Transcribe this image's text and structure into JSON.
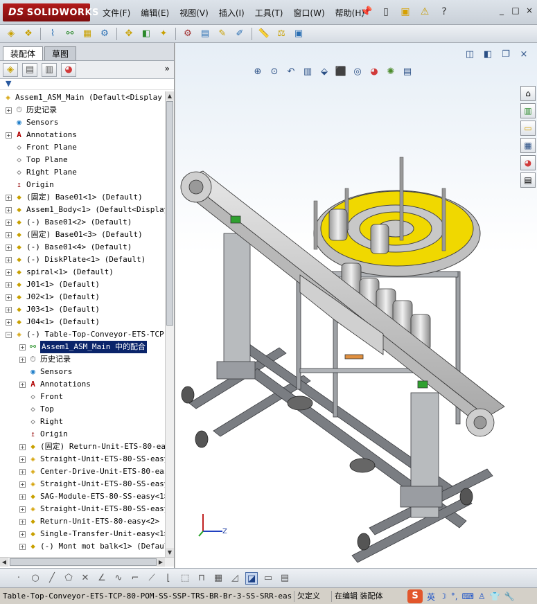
{
  "titlebar": {
    "logo_text": "SOLIDWORKS",
    "logo_prefix": "DS",
    "menus": [
      "文件(F)",
      "编辑(E)",
      "视图(V)",
      "插入(I)",
      "工具(T)",
      "窗口(W)",
      "帮助(H)"
    ],
    "question": "?",
    "win_buttons": [
      "_",
      "□",
      "×"
    ]
  },
  "left_panel": {
    "tabs": [
      "装配体",
      "草图"
    ],
    "active_tab": 0,
    "more": "»",
    "filter": "▼",
    "tree": [
      {
        "level": 0,
        "exp": "",
        "icon": "asm",
        "label": "Assem1_ASM_Main  (Default<Display S"
      },
      {
        "level": 1,
        "exp": "+",
        "icon": "hist",
        "label": "历史记录"
      },
      {
        "level": 1,
        "exp": "",
        "icon": "sens",
        "label": "Sensors"
      },
      {
        "level": 1,
        "exp": "+",
        "icon": "ann",
        "label": "Annotations"
      },
      {
        "level": 1,
        "exp": "",
        "icon": "plane",
        "label": "Front Plane"
      },
      {
        "level": 1,
        "exp": "",
        "icon": "plane",
        "label": "Top Plane"
      },
      {
        "level": 1,
        "exp": "",
        "icon": "plane",
        "label": "Right Plane"
      },
      {
        "level": 1,
        "exp": "",
        "icon": "orig",
        "label": "Origin"
      },
      {
        "level": 1,
        "exp": "+",
        "icon": "part",
        "label": "(固定) Base01<1> (Default)"
      },
      {
        "level": 1,
        "exp": "+",
        "icon": "part",
        "label": "Assem1_Body<1> (Default<Display"
      },
      {
        "level": 1,
        "exp": "+",
        "icon": "part",
        "label": "(-) Base01<2> (Default)"
      },
      {
        "level": 1,
        "exp": "+",
        "icon": "part",
        "label": "(固定) Base01<3> (Default)"
      },
      {
        "level": 1,
        "exp": "+",
        "icon": "part",
        "label": "(-) Base01<4> (Default)"
      },
      {
        "level": 1,
        "exp": "+",
        "icon": "part",
        "label": "(-) DiskPlate<1> (Default)"
      },
      {
        "level": 1,
        "exp": "+",
        "icon": "part",
        "label": "spiral<1> (Default)"
      },
      {
        "level": 1,
        "exp": "+",
        "icon": "part",
        "label": "J01<1> (Default)"
      },
      {
        "level": 1,
        "exp": "+",
        "icon": "part",
        "label": "J02<1> (Default)"
      },
      {
        "level": 1,
        "exp": "+",
        "icon": "part",
        "label": "J03<1> (Default)"
      },
      {
        "level": 1,
        "exp": "+",
        "icon": "part",
        "label": "J04<1> (Default)"
      },
      {
        "level": 1,
        "exp": "−",
        "icon": "asm",
        "label": "(-) Table-Top-Conveyor-ETS-TCP-8"
      },
      {
        "level": 2,
        "exp": "+",
        "icon": "mate",
        "label": "Assem1_ASM_Main 中的配合",
        "selected": true
      },
      {
        "level": 2,
        "exp": "+",
        "icon": "hist",
        "label": "历史记录"
      },
      {
        "level": 2,
        "exp": "",
        "icon": "sens",
        "label": "Sensors"
      },
      {
        "level": 2,
        "exp": "+",
        "icon": "ann",
        "label": "Annotations"
      },
      {
        "level": 2,
        "exp": "",
        "icon": "plane",
        "label": "Front"
      },
      {
        "level": 2,
        "exp": "",
        "icon": "plane",
        "label": "Top"
      },
      {
        "level": 2,
        "exp": "",
        "icon": "plane",
        "label": "Right"
      },
      {
        "level": 2,
        "exp": "",
        "icon": "orig",
        "label": "Origin"
      },
      {
        "level": 2,
        "exp": "+",
        "icon": "part",
        "label": "(固定) Return-Unit-ETS-80-eas"
      },
      {
        "level": 2,
        "exp": "+",
        "icon": "asm",
        "label": "Straight-Unit-ETS-80-SS-easy<"
      },
      {
        "level": 2,
        "exp": "+",
        "icon": "asm",
        "label": "Center-Drive-Unit-ETS-80-easy"
      },
      {
        "level": 2,
        "exp": "+",
        "icon": "asm",
        "label": "Straight-Unit-ETS-80-SS-easy<"
      },
      {
        "level": 2,
        "exp": "+",
        "icon": "part",
        "label": "SAG-Module-ETS-80-SS-easy<1>"
      },
      {
        "level": 2,
        "exp": "+",
        "icon": "asm",
        "label": "Straight-Unit-ETS-80-SS-easy<"
      },
      {
        "level": 2,
        "exp": "+",
        "icon": "part",
        "label": "Return-Unit-ETS-80-easy<2> (R"
      },
      {
        "level": 2,
        "exp": "+",
        "icon": "part",
        "label": "Single-Transfer-Unit-easy<1>"
      },
      {
        "level": 2,
        "exp": "+",
        "icon": "part",
        "label": "(-) Mont mot balk<1> (Default"
      }
    ]
  },
  "viewport": {
    "triad_axis": "Z"
  },
  "statusbar": {
    "file": "Table-Top-Conveyor-ETS-TCP-80-POM-SS-SSP-TRS-BR-Br-3-SS-SRR-easy<...",
    "definition": "欠定义",
    "mode": "在编辑 装配体",
    "ime_logo": "S",
    "ime_lang": "英"
  },
  "colors": {
    "logo_red": "#a11616",
    "selection": "#0a246a",
    "frame_gray": "#a9acb0",
    "bowl_yellow": "#f0d800",
    "bottle_gray": "#c8c8c8"
  }
}
